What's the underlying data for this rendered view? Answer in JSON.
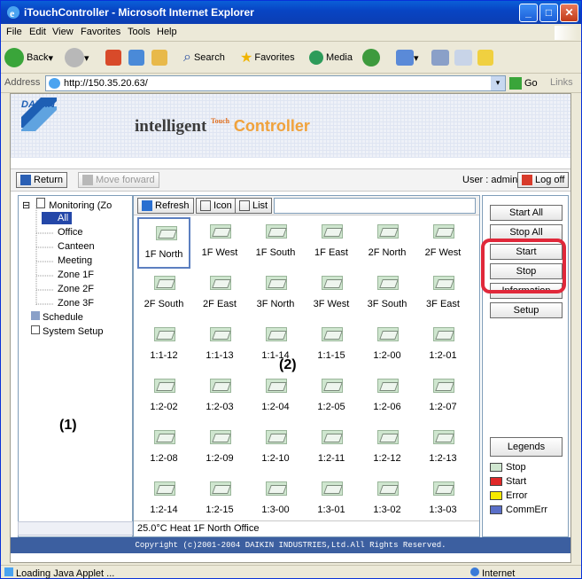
{
  "window": {
    "title": "iTouchController - Microsoft Internet Explorer"
  },
  "menu": [
    "File",
    "Edit",
    "View",
    "Favorites",
    "Tools",
    "Help"
  ],
  "toolbar": {
    "back": "Back",
    "search": "Search",
    "favorites": "Favorites",
    "media": "Media"
  },
  "address": {
    "label": "Address",
    "url": "http://150.35.20.63/",
    "go": "Go",
    "links": "Links"
  },
  "brand": {
    "daikin": "DAIKIN",
    "intelligent": "intelligent",
    "touch": "Touch",
    "controller": "Controller"
  },
  "appbar": {
    "return": "Return",
    "forward": "Move forward",
    "user": "User : admin",
    "logoff": "Log off"
  },
  "tree": {
    "root": "Monitoring (Zo",
    "items": [
      "All",
      "Office",
      "Canteen",
      "Meeting",
      "Zone 1F",
      "Zone 2F",
      "Zone 3F"
    ],
    "schedule": "Schedule",
    "setup": "System Setup"
  },
  "viewtools": {
    "refresh": "Refresh",
    "icon": "Icon",
    "list": "List"
  },
  "units": [
    "1F North",
    "1F West",
    "1F South",
    "1F East",
    "2F North",
    "2F West",
    "2F South",
    "2F East",
    "3F North",
    "3F West",
    "3F South",
    "3F East",
    "1:1-12",
    "1:1-13",
    "1:1-14",
    "1:1-15",
    "1:2-00",
    "1:2-01",
    "1:2-02",
    "1:2-03",
    "1:2-04",
    "1:2-05",
    "1:2-06",
    "1:2-07",
    "1:2-08",
    "1:2-09",
    "1:2-10",
    "1:2-11",
    "1:2-12",
    "1:2-13",
    "1:2-14",
    "1:2-15",
    "1:3-00",
    "1:3-01",
    "1:3-02",
    "1:3-03"
  ],
  "status_line": "25.0°C Heat 1F North Office",
  "actions": [
    "Start All",
    "Stop All",
    "Start",
    "Stop",
    "Information",
    "Setup"
  ],
  "legends": {
    "title": "Legends",
    "items": [
      {
        "label": "Stop",
        "color": "#cfe6cf"
      },
      {
        "label": "Start",
        "color": "#e02828"
      },
      {
        "label": "Error",
        "color": "#f5e800"
      },
      {
        "label": "CommErr",
        "color": "#5a6fc8"
      }
    ]
  },
  "copyright": "Copyright (c)2001-2004 DAIKIN INDUSTRIES,Ltd.All Rights Reserved.",
  "annotations": {
    "one": "(1)",
    "two": "(2)"
  },
  "statusbar": {
    "left": "Loading Java Applet ...",
    "zone": "Internet"
  }
}
